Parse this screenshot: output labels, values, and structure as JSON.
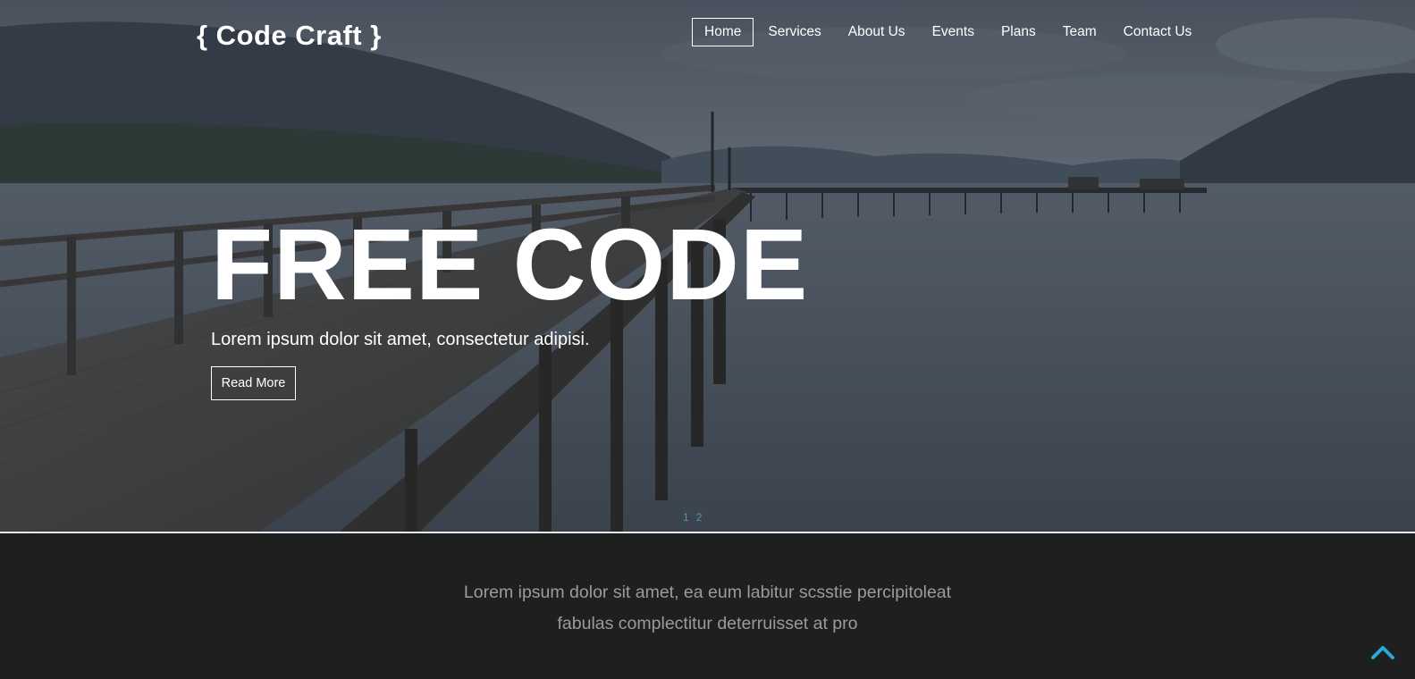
{
  "brand": {
    "logo_text": "{ Code Craft }"
  },
  "nav": {
    "items": [
      {
        "label": "Home",
        "active": true
      },
      {
        "label": "Services",
        "active": false
      },
      {
        "label": "About Us",
        "active": false
      },
      {
        "label": "Events",
        "active": false
      },
      {
        "label": "Plans",
        "active": false
      },
      {
        "label": "Team",
        "active": false
      },
      {
        "label": "Contact Us",
        "active": false
      }
    ]
  },
  "hero": {
    "title": "FREE CODE",
    "subtitle": "Lorem ipsum dolor sit amet, consectetur adipisi.",
    "button_label": "Read More",
    "slider_dots": [
      "1",
      "2"
    ]
  },
  "about": {
    "line1": "Lorem ipsum dolor sit amet, ea eum labitur scsstie percipitoleat",
    "line2": "fabulas complectitur deterruisset at pro"
  },
  "icons": {
    "scroll_top": "chevron-up-icon"
  },
  "colors": {
    "accent": "#2aa8d8",
    "footer_bg": "#1e2020",
    "footer_text": "#9a9c9c"
  }
}
